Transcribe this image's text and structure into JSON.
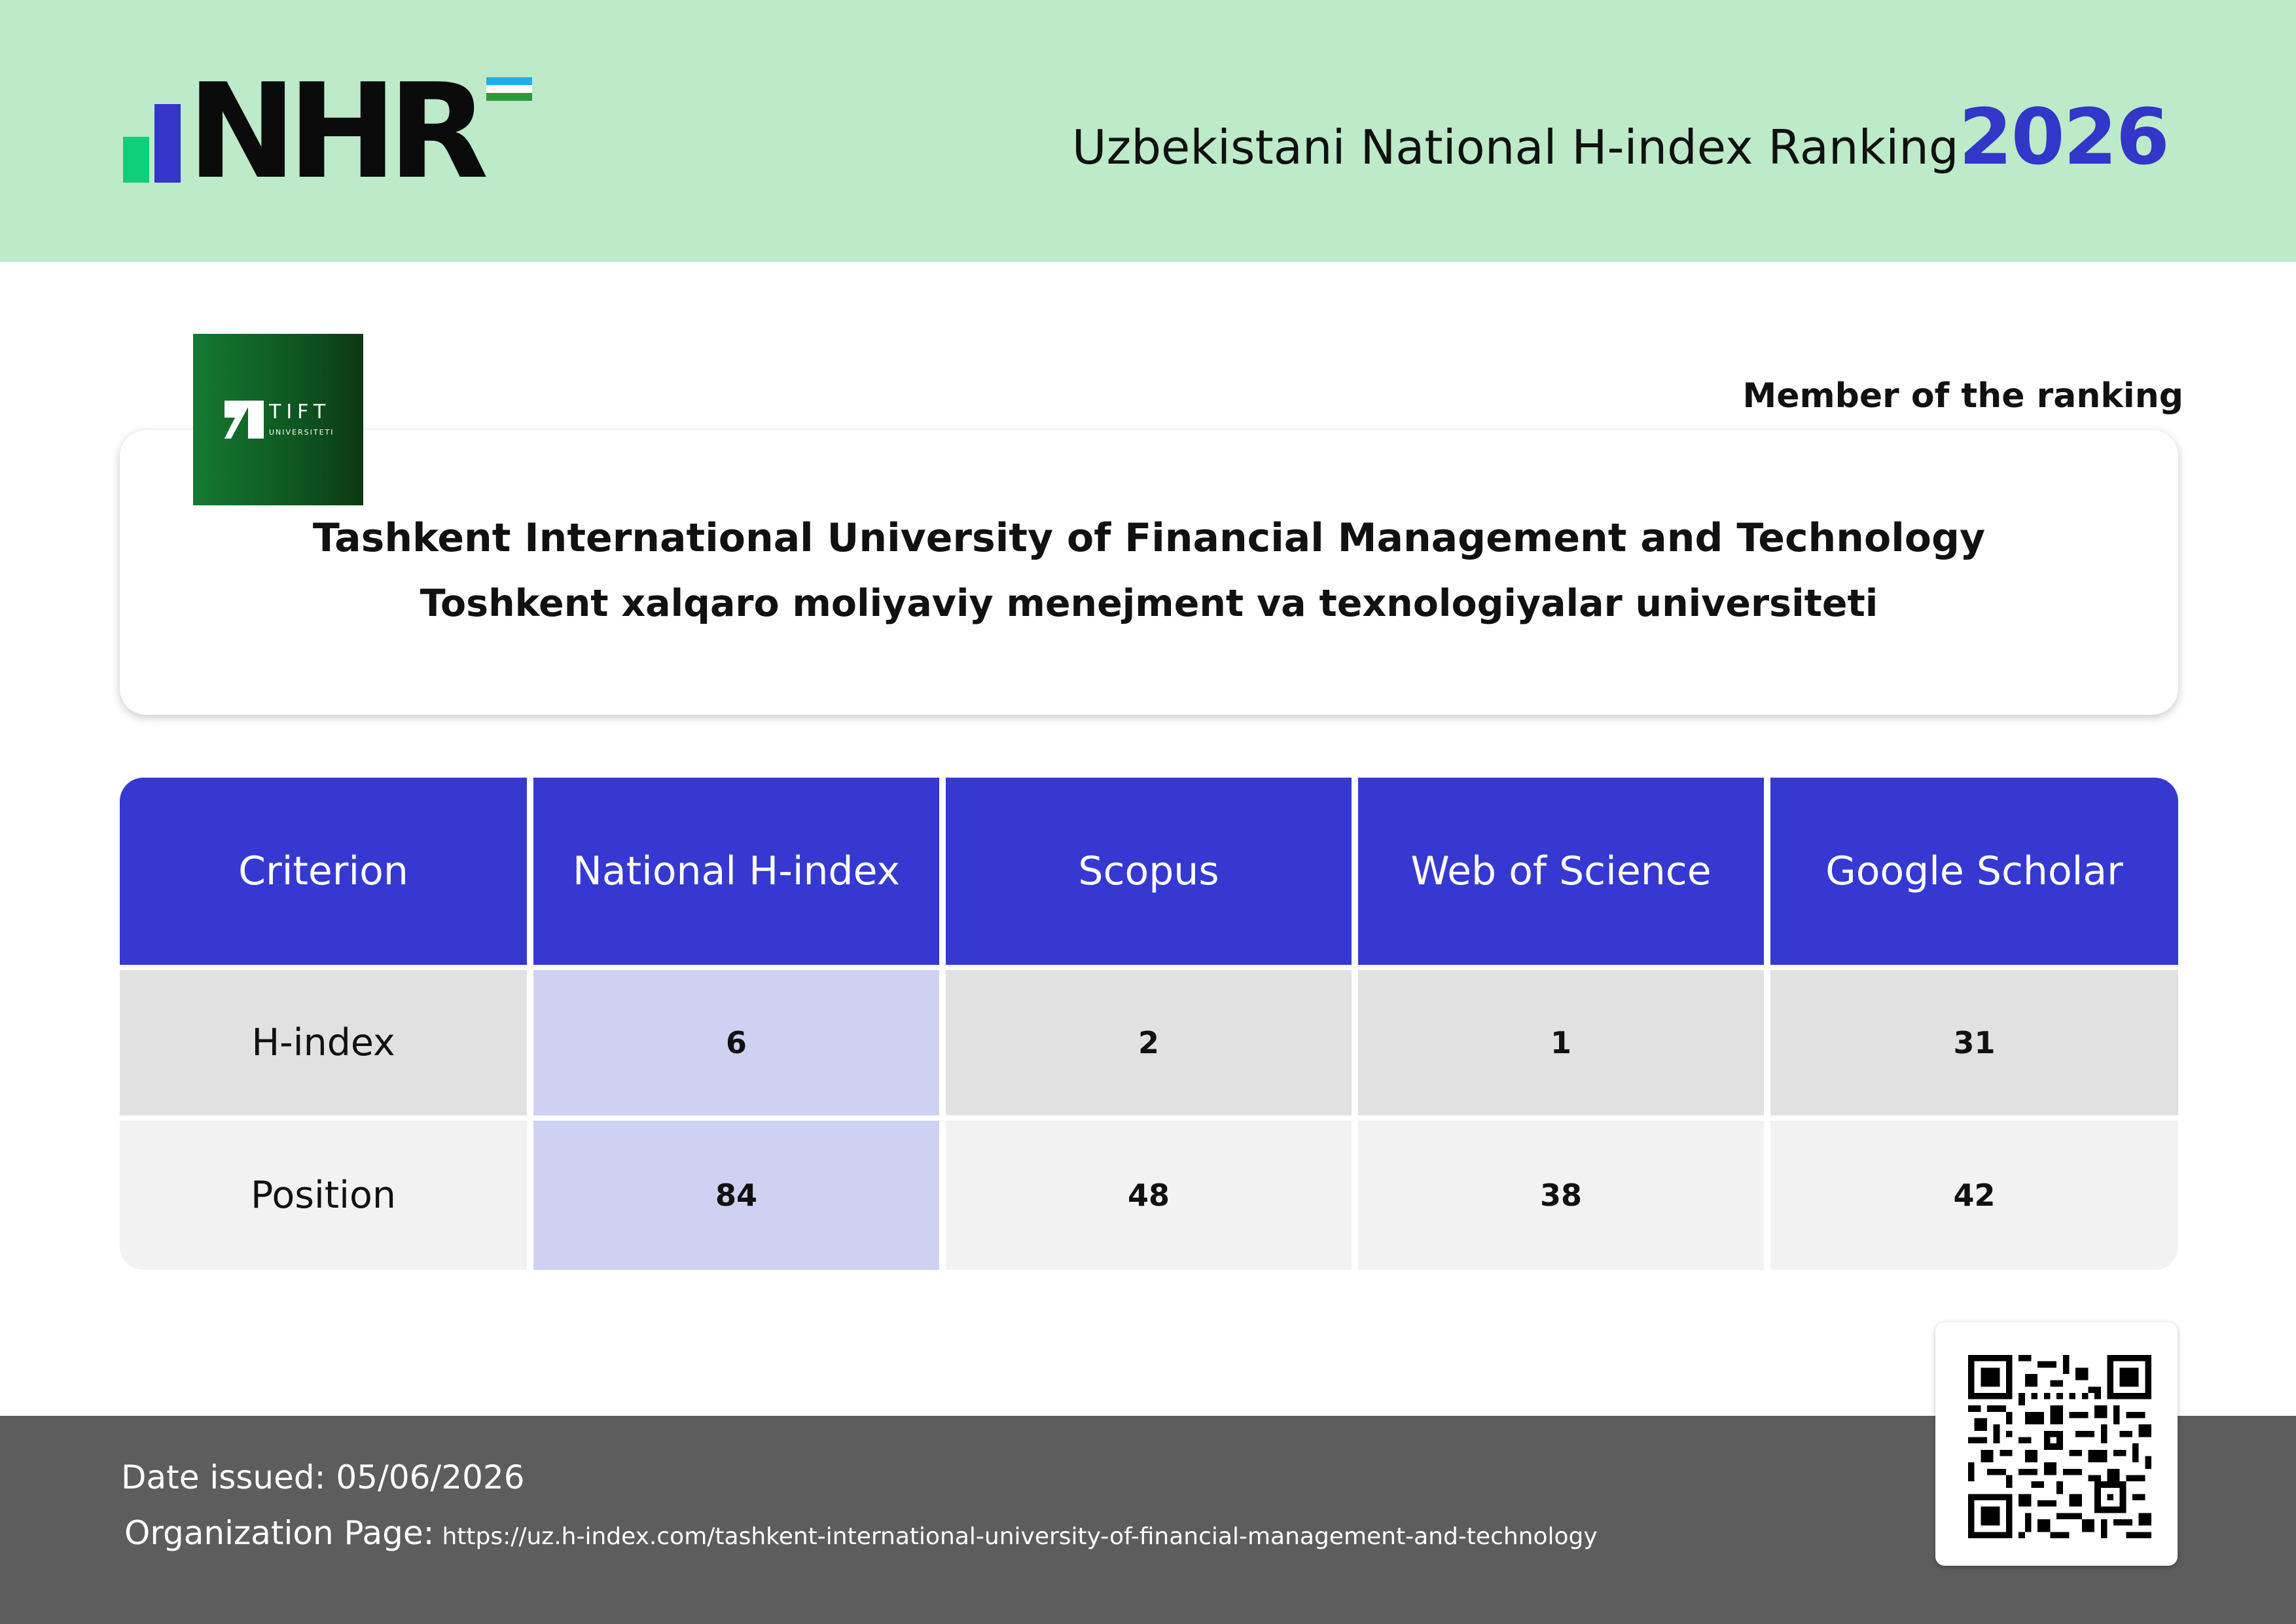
{
  "header": {
    "logo_text": "NHR",
    "title": "Uzbekistani National H-index Ranking",
    "year": "2026",
    "colors": {
      "background": "#bdeac8",
      "accent": "#3237c9",
      "logo_bar_green": "#0fcf7c"
    }
  },
  "member_label": "Member of the ranking",
  "university": {
    "logo_word": "TIFT",
    "logo_sub": "UNIVERSITETI",
    "name_en": "Tashkent International University of Financial Management and Technology",
    "name_uz": "Toshkent xalqaro moliyaviy menejment va texnologiyalar universiteti"
  },
  "table": {
    "headers": [
      "Criterion",
      "National H-index",
      "Scopus",
      "Web of Science",
      "Google Scholar"
    ],
    "rows": [
      {
        "label": "H-index",
        "values": [
          "6",
          "2",
          "1",
          "31"
        ]
      },
      {
        "label": "Position",
        "values": [
          "84",
          "48",
          "38",
          "42"
        ]
      }
    ],
    "colors": {
      "header": "#3539d1",
      "row1": "#e1e1e1",
      "row2": "#f2f2f2",
      "highlight": "#cfd1f2"
    }
  },
  "footer": {
    "date_label": "Date issued:",
    "date_value": "05/06/2026",
    "org_label": "Organization Page:",
    "org_url": "https://uz.h-index.com/tashkent-international-university-of-financial-management-and-technology",
    "qr_icon": "qr-code-icon",
    "background": "#5d5d5d"
  }
}
